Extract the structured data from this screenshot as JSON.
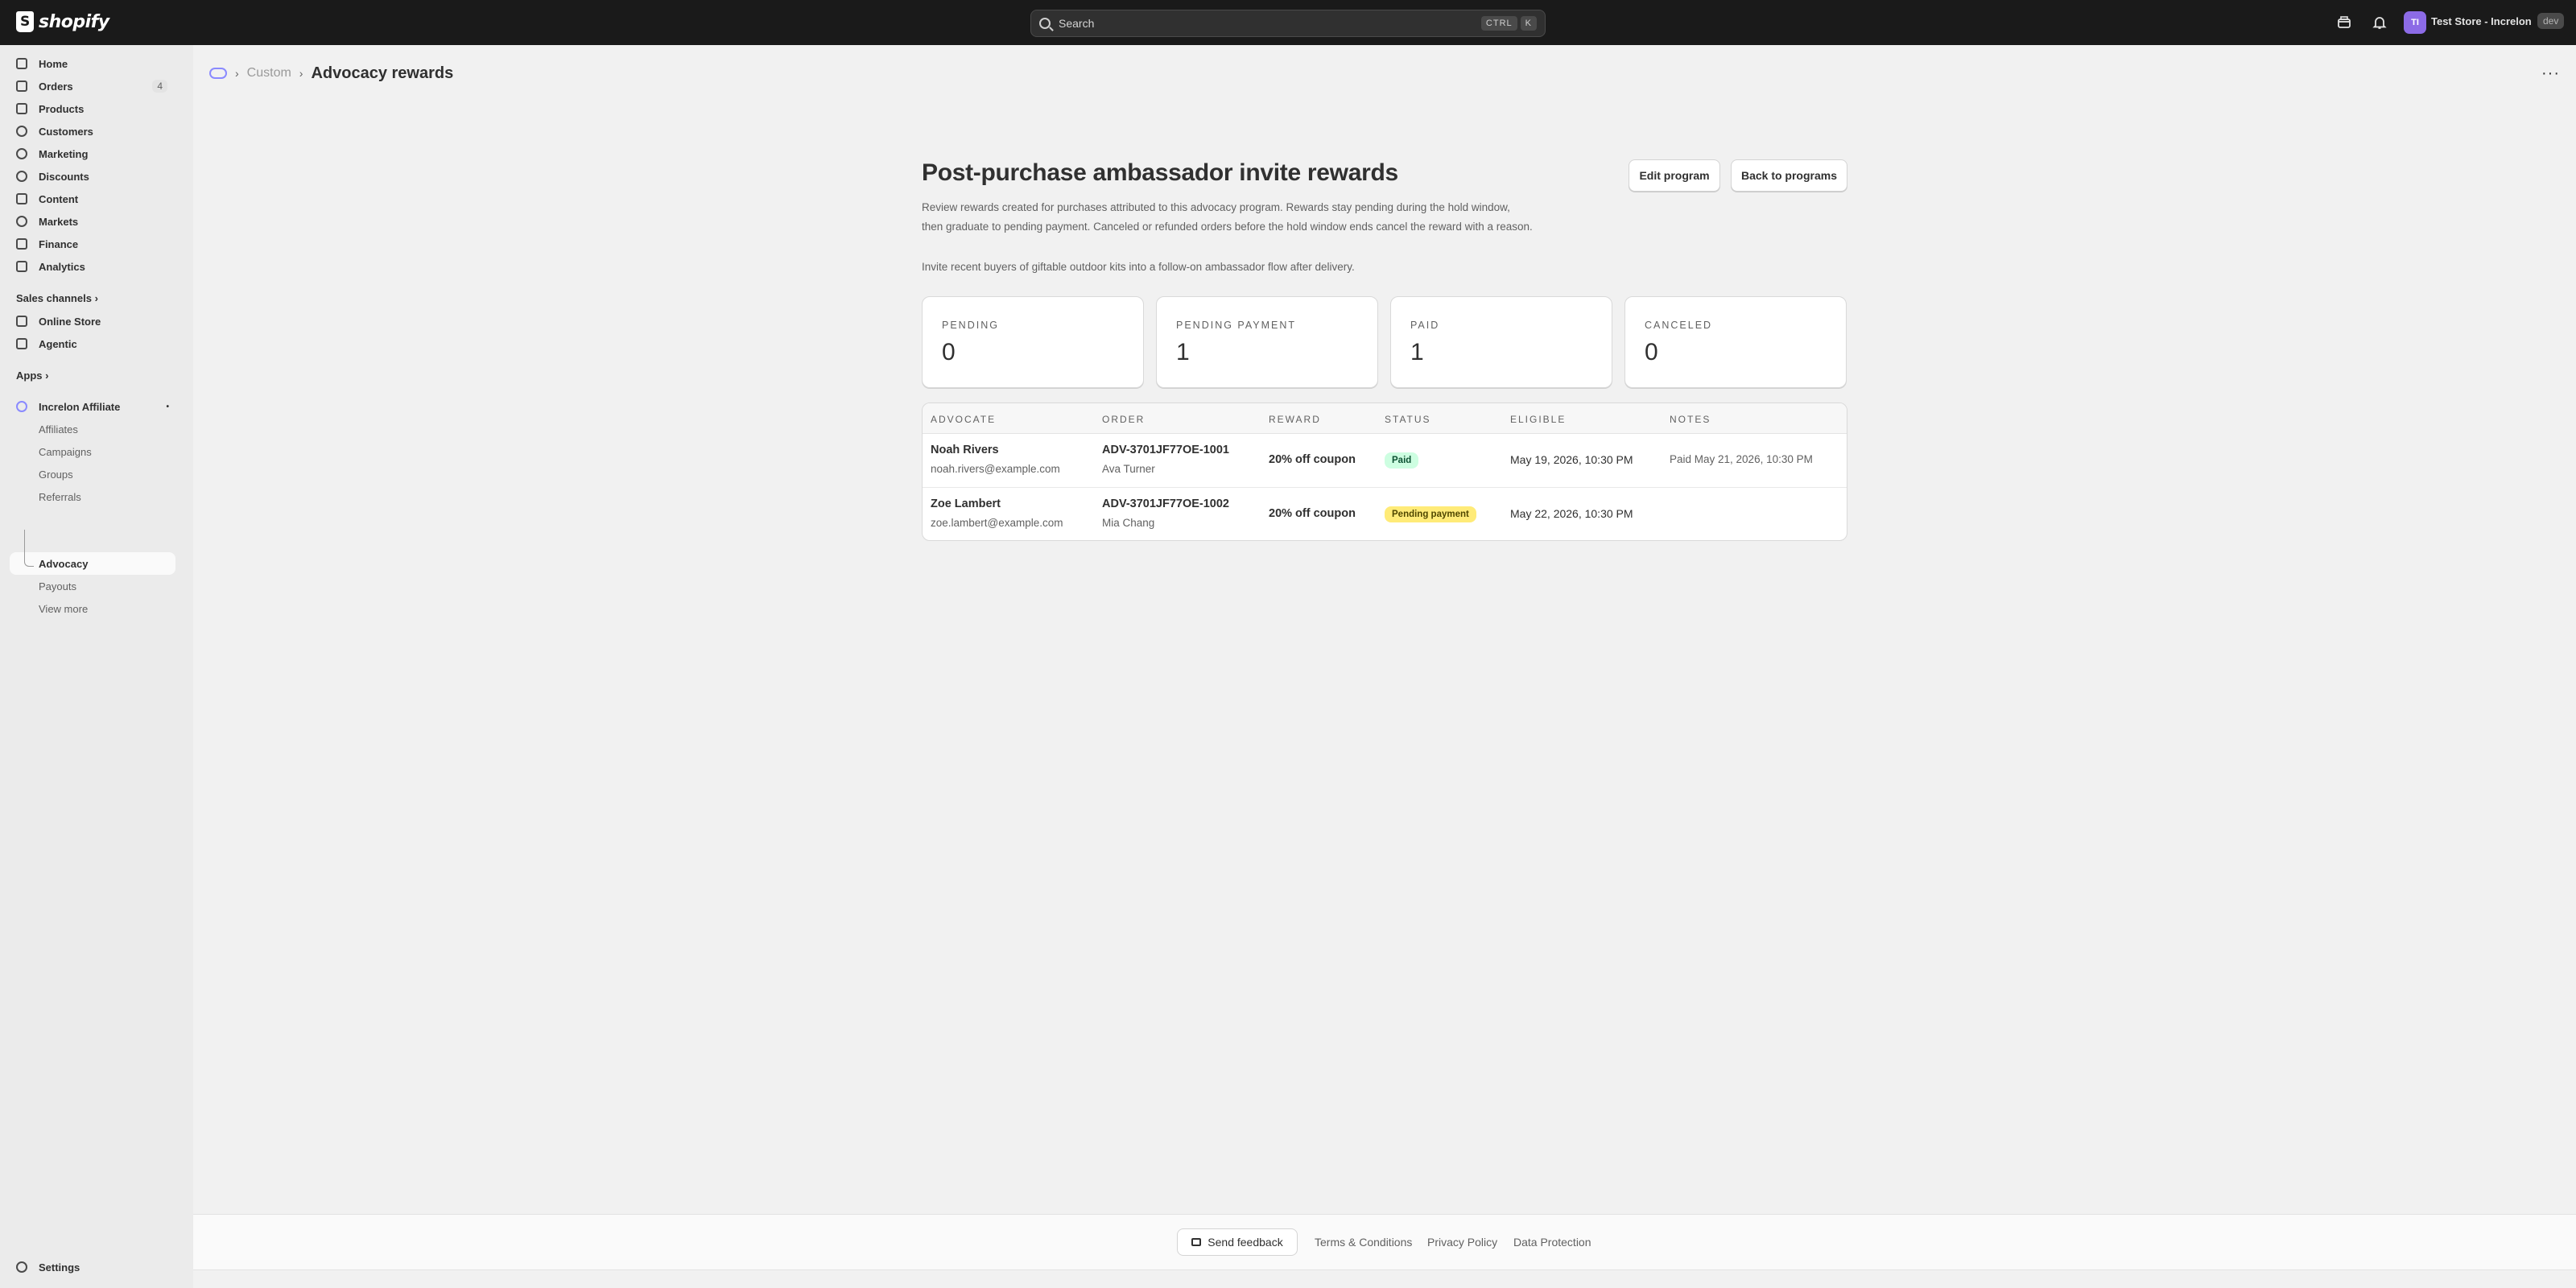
{
  "topbar": {
    "logo_text": "shopify",
    "search_placeholder": "Search",
    "shortcut_key1": "CTRL",
    "shortcut_key2": "K",
    "store_initials": "TI",
    "store_name": "Test Store - Increlon",
    "store_badge": "dev"
  },
  "sidebar": {
    "items": [
      {
        "label": "Home",
        "icon": "home-icon"
      },
      {
        "label": "Orders",
        "icon": "orders-icon",
        "count": "4"
      },
      {
        "label": "Products",
        "icon": "tag-icon"
      },
      {
        "label": "Customers",
        "icon": "person-icon"
      },
      {
        "label": "Marketing",
        "icon": "target-icon"
      },
      {
        "label": "Discounts",
        "icon": "discount-icon"
      },
      {
        "label": "Content",
        "icon": "content-icon"
      },
      {
        "label": "Markets",
        "icon": "globe-icon"
      },
      {
        "label": "Finance",
        "icon": "bank-icon"
      },
      {
        "label": "Analytics",
        "icon": "chart-icon"
      }
    ],
    "sales_channels_label": "Sales channels",
    "channels": [
      {
        "label": "Online Store",
        "icon": "store-icon"
      },
      {
        "label": "Agentic",
        "icon": "agentic-icon"
      }
    ],
    "apps_label": "Apps",
    "app_name": "Increlon Affiliate",
    "app_items": [
      "Affiliates",
      "Campaigns",
      "Groups",
      "Referrals",
      "Advocacy",
      "Payouts",
      "View more"
    ],
    "settings_label": "Settings"
  },
  "breadcrumb": {
    "parent": "Custom",
    "current": "Advocacy rewards"
  },
  "page": {
    "title": "Post-purchase ambassador invite rewards",
    "edit_button": "Edit program",
    "back_button": "Back to programs",
    "description": "Review rewards created for purchases attributed to this advocacy program. Rewards stay pending during the hold window, then graduate to pending payment. Canceled or refunded orders before the hold window ends cancel the reward with a reason.",
    "subdescription": "Invite recent buyers of giftable outdoor kits into a follow-on ambassador flow after delivery."
  },
  "stats": [
    {
      "label": "PENDING",
      "value": "0"
    },
    {
      "label": "PENDING PAYMENT",
      "value": "1"
    },
    {
      "label": "PAID",
      "value": "1"
    },
    {
      "label": "CANCELED",
      "value": "0"
    }
  ],
  "table": {
    "headers": [
      "ADVOCATE",
      "ORDER",
      "REWARD",
      "STATUS",
      "ELIGIBLE",
      "NOTES"
    ],
    "rows": [
      {
        "advocate": "Noah Rivers",
        "email": "noah.rivers@example.com",
        "order": "ADV-3701JF77OE-1001",
        "customer": "Ava Turner",
        "reward": "20% off coupon",
        "status": "Paid",
        "status_color": "#cdfee1",
        "status_text_color": "#0c5132",
        "eligible": "May 19, 2026, 10:30 PM",
        "notes": "Paid May 21, 2026, 10:30 PM"
      },
      {
        "advocate": "Zoe Lambert",
        "email": "zoe.lambert@example.com",
        "order": "ADV-3701JF77OE-1002",
        "customer": "Mia Chang",
        "reward": "20% off coupon",
        "status": "Pending payment",
        "status_color": "#ffeb78",
        "status_text_color": "#4f4700",
        "eligible": "May 22, 2026, 10:30 PM",
        "notes": ""
      }
    ]
  },
  "footer": {
    "feedback": "Send feedback",
    "links": [
      "Terms & Conditions",
      "Privacy Policy",
      "Data Protection"
    ]
  }
}
